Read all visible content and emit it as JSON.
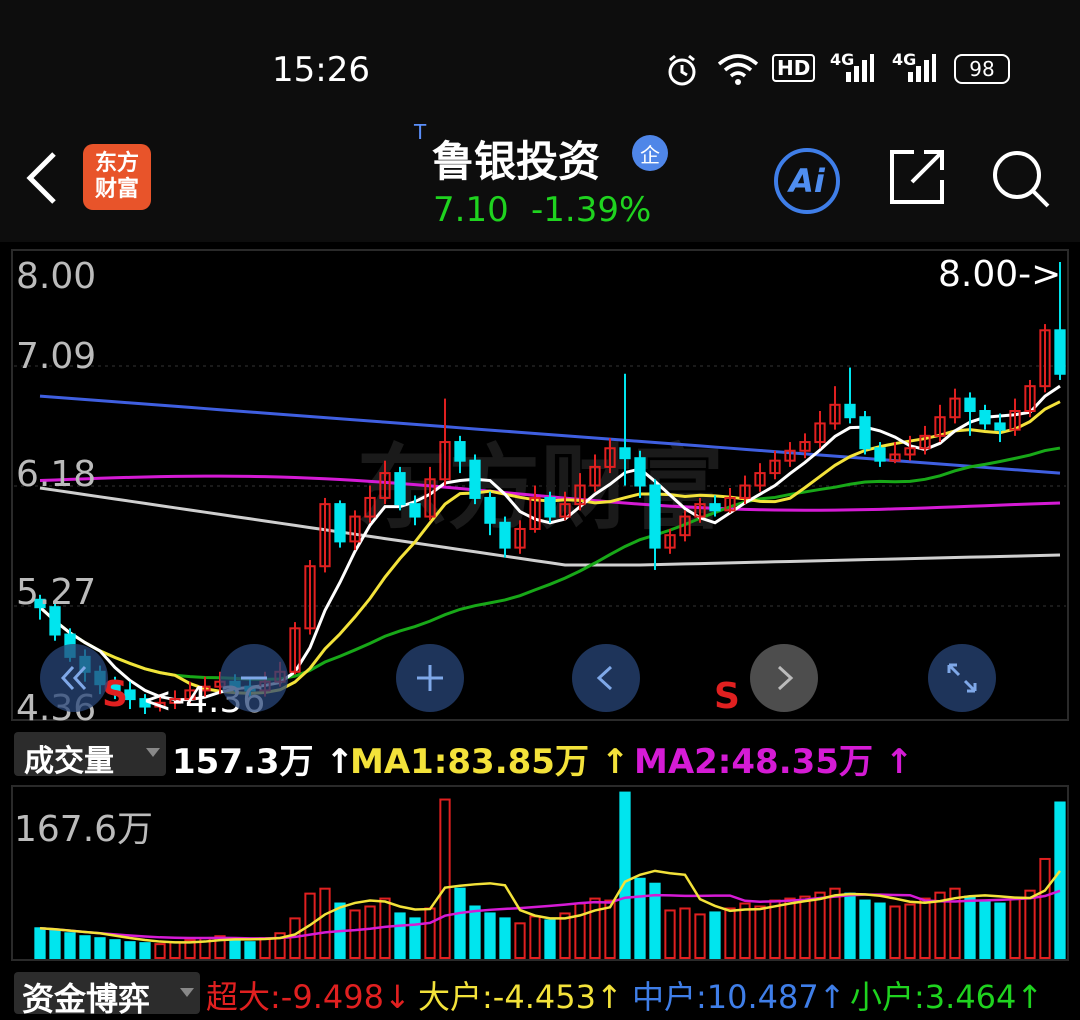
{
  "status": {
    "time": "15:26",
    "battery": "98",
    "hd": "HD",
    "net1": "4G",
    "net2": "4G"
  },
  "header": {
    "logo_line1": "东方",
    "logo_line2": "财富",
    "t_mark": "T",
    "title": "鲁银投资",
    "qi_badge": "企",
    "price": "7.10",
    "change": "-1.39%",
    "ai_label": "Ai"
  },
  "price_chart": {
    "y_labels": [
      "8.00",
      "7.09",
      "6.18",
      "5.27",
      "4.36"
    ],
    "max_label": "8.00->",
    "min_label": "<-4.36",
    "sell_marks": [
      "S",
      "S"
    ],
    "watermark": "东方财富"
  },
  "volume": {
    "selector": "成交量",
    "value": "157.3万",
    "ma1": "MA1:83.85万",
    "ma2": "MA2:48.35万",
    "up_arrow": "↑",
    "scale_label": "167.6万"
  },
  "fund": {
    "selector": "资金博弈",
    "super": "超大:-9.498",
    "super_arrow": "↓",
    "large": "大户:-4.453",
    "large_arrow": "↑",
    "medium": "中户:10.487",
    "medium_arrow": "↑",
    "small": "小户:3.464",
    "small_arrow": "↑"
  },
  "colors": {
    "up": "#e02020",
    "down": "#00e5ee",
    "ma_white": "#ffffff",
    "ma_yellow": "#f3e23a",
    "ma_blue": "#3f5fe0",
    "ma_magenta": "#d51bd5",
    "ma_green": "#18a818",
    "ma_gray": "#cfcfcf"
  },
  "chart_data": {
    "type": "candlestick",
    "ylim": [
      4.36,
      8.0
    ],
    "candles": [
      [
        5.28,
        5.22,
        5.32,
        5.12
      ],
      [
        5.22,
        5.0,
        5.25,
        4.95
      ],
      [
        5.0,
        4.82,
        5.05,
        4.78
      ],
      [
        4.82,
        4.7,
        4.88,
        4.62
      ],
      [
        4.7,
        4.6,
        4.75,
        4.52
      ],
      [
        4.6,
        4.55,
        4.66,
        4.48
      ],
      [
        4.55,
        4.48,
        4.62,
        4.4
      ],
      [
        4.48,
        4.42,
        4.52,
        4.36
      ],
      [
        4.42,
        4.45,
        4.52,
        4.38
      ],
      [
        4.45,
        4.48,
        4.55,
        4.4
      ],
      [
        4.48,
        4.55,
        4.62,
        4.44
      ],
      [
        4.55,
        4.58,
        4.66,
        4.5
      ],
      [
        4.58,
        4.62,
        4.7,
        4.52
      ],
      [
        4.62,
        4.58,
        4.68,
        4.54
      ],
      [
        4.58,
        4.55,
        4.64,
        4.5
      ],
      [
        4.55,
        4.62,
        4.7,
        4.5
      ],
      [
        4.62,
        4.7,
        4.78,
        4.58
      ],
      [
        4.7,
        5.05,
        5.1,
        4.68
      ],
      [
        5.05,
        5.55,
        5.6,
        5.0
      ],
      [
        5.55,
        6.05,
        6.1,
        5.5
      ],
      [
        6.05,
        5.75,
        6.08,
        5.7
      ],
      [
        5.75,
        5.95,
        6.0,
        5.68
      ],
      [
        5.95,
        6.1,
        6.2,
        5.9
      ],
      [
        6.1,
        6.3,
        6.4,
        6.05
      ],
      [
        6.3,
        6.05,
        6.35,
        6.0
      ],
      [
        6.05,
        5.95,
        6.12,
        5.88
      ],
      [
        5.95,
        6.25,
        6.35,
        5.92
      ],
      [
        6.25,
        6.55,
        6.9,
        6.2
      ],
      [
        6.55,
        6.4,
        6.6,
        6.3
      ],
      [
        6.4,
        6.1,
        6.45,
        6.05
      ],
      [
        6.1,
        5.9,
        6.15,
        5.8
      ],
      [
        5.9,
        5.7,
        5.95,
        5.62
      ],
      [
        5.7,
        5.85,
        5.92,
        5.65
      ],
      [
        5.85,
        6.1,
        6.2,
        5.82
      ],
      [
        6.1,
        5.95,
        6.15,
        5.9
      ],
      [
        5.95,
        6.05,
        6.15,
        5.92
      ],
      [
        6.05,
        6.2,
        6.3,
        6.0
      ],
      [
        6.2,
        6.35,
        6.45,
        6.15
      ],
      [
        6.35,
        6.5,
        6.58,
        6.3
      ],
      [
        6.5,
        6.42,
        7.1,
        6.2
      ],
      [
        6.42,
        6.2,
        6.48,
        6.1
      ],
      [
        6.2,
        5.7,
        6.25,
        5.52
      ],
      [
        5.7,
        5.8,
        5.85,
        5.65
      ],
      [
        5.8,
        5.95,
        6.0,
        5.75
      ],
      [
        5.95,
        6.05,
        6.1,
        5.9
      ],
      [
        6.05,
        6.0,
        6.12,
        5.95
      ],
      [
        6.0,
        6.1,
        6.18,
        5.98
      ],
      [
        6.1,
        6.2,
        6.28,
        6.05
      ],
      [
        6.2,
        6.3,
        6.38,
        6.15
      ],
      [
        6.3,
        6.4,
        6.48,
        6.25
      ],
      [
        6.4,
        6.48,
        6.55,
        6.35
      ],
      [
        6.48,
        6.55,
        6.62,
        6.42
      ],
      [
        6.55,
        6.7,
        6.8,
        6.5
      ],
      [
        6.7,
        6.85,
        7.0,
        6.65
      ],
      [
        6.85,
        6.75,
        7.15,
        6.7
      ],
      [
        6.75,
        6.5,
        6.8,
        6.45
      ],
      [
        6.5,
        6.4,
        6.55,
        6.35
      ],
      [
        6.4,
        6.45,
        6.55,
        6.38
      ],
      [
        6.45,
        6.5,
        6.6,
        6.4
      ],
      [
        6.5,
        6.6,
        6.68,
        6.45
      ],
      [
        6.6,
        6.75,
        6.85,
        6.55
      ],
      [
        6.75,
        6.9,
        6.98,
        6.7
      ],
      [
        6.9,
        6.8,
        6.95,
        6.6
      ],
      [
        6.8,
        6.7,
        6.85,
        6.65
      ],
      [
        6.7,
        6.65,
        6.78,
        6.55
      ],
      [
        6.65,
        6.8,
        6.9,
        6.6
      ],
      [
        6.8,
        7.0,
        7.05,
        6.75
      ],
      [
        7.0,
        7.45,
        7.5,
        6.95
      ],
      [
        7.45,
        7.1,
        8.0,
        7.05
      ]
    ],
    "volumes": [
      30,
      28,
      25,
      22,
      20,
      18,
      16,
      15,
      14,
      16,
      18,
      20,
      22,
      18,
      16,
      20,
      25,
      40,
      65,
      70,
      55,
      48,
      52,
      60,
      45,
      40,
      50,
      160,
      70,
      52,
      45,
      40,
      35,
      42,
      38,
      45,
      55,
      60,
      58,
      167,
      80,
      75,
      48,
      50,
      44,
      46,
      50,
      55,
      52,
      58,
      60,
      62,
      66,
      70,
      65,
      58,
      55,
      52,
      54,
      60,
      66,
      70,
      62,
      58,
      55,
      60,
      68,
      100,
      157
    ]
  }
}
